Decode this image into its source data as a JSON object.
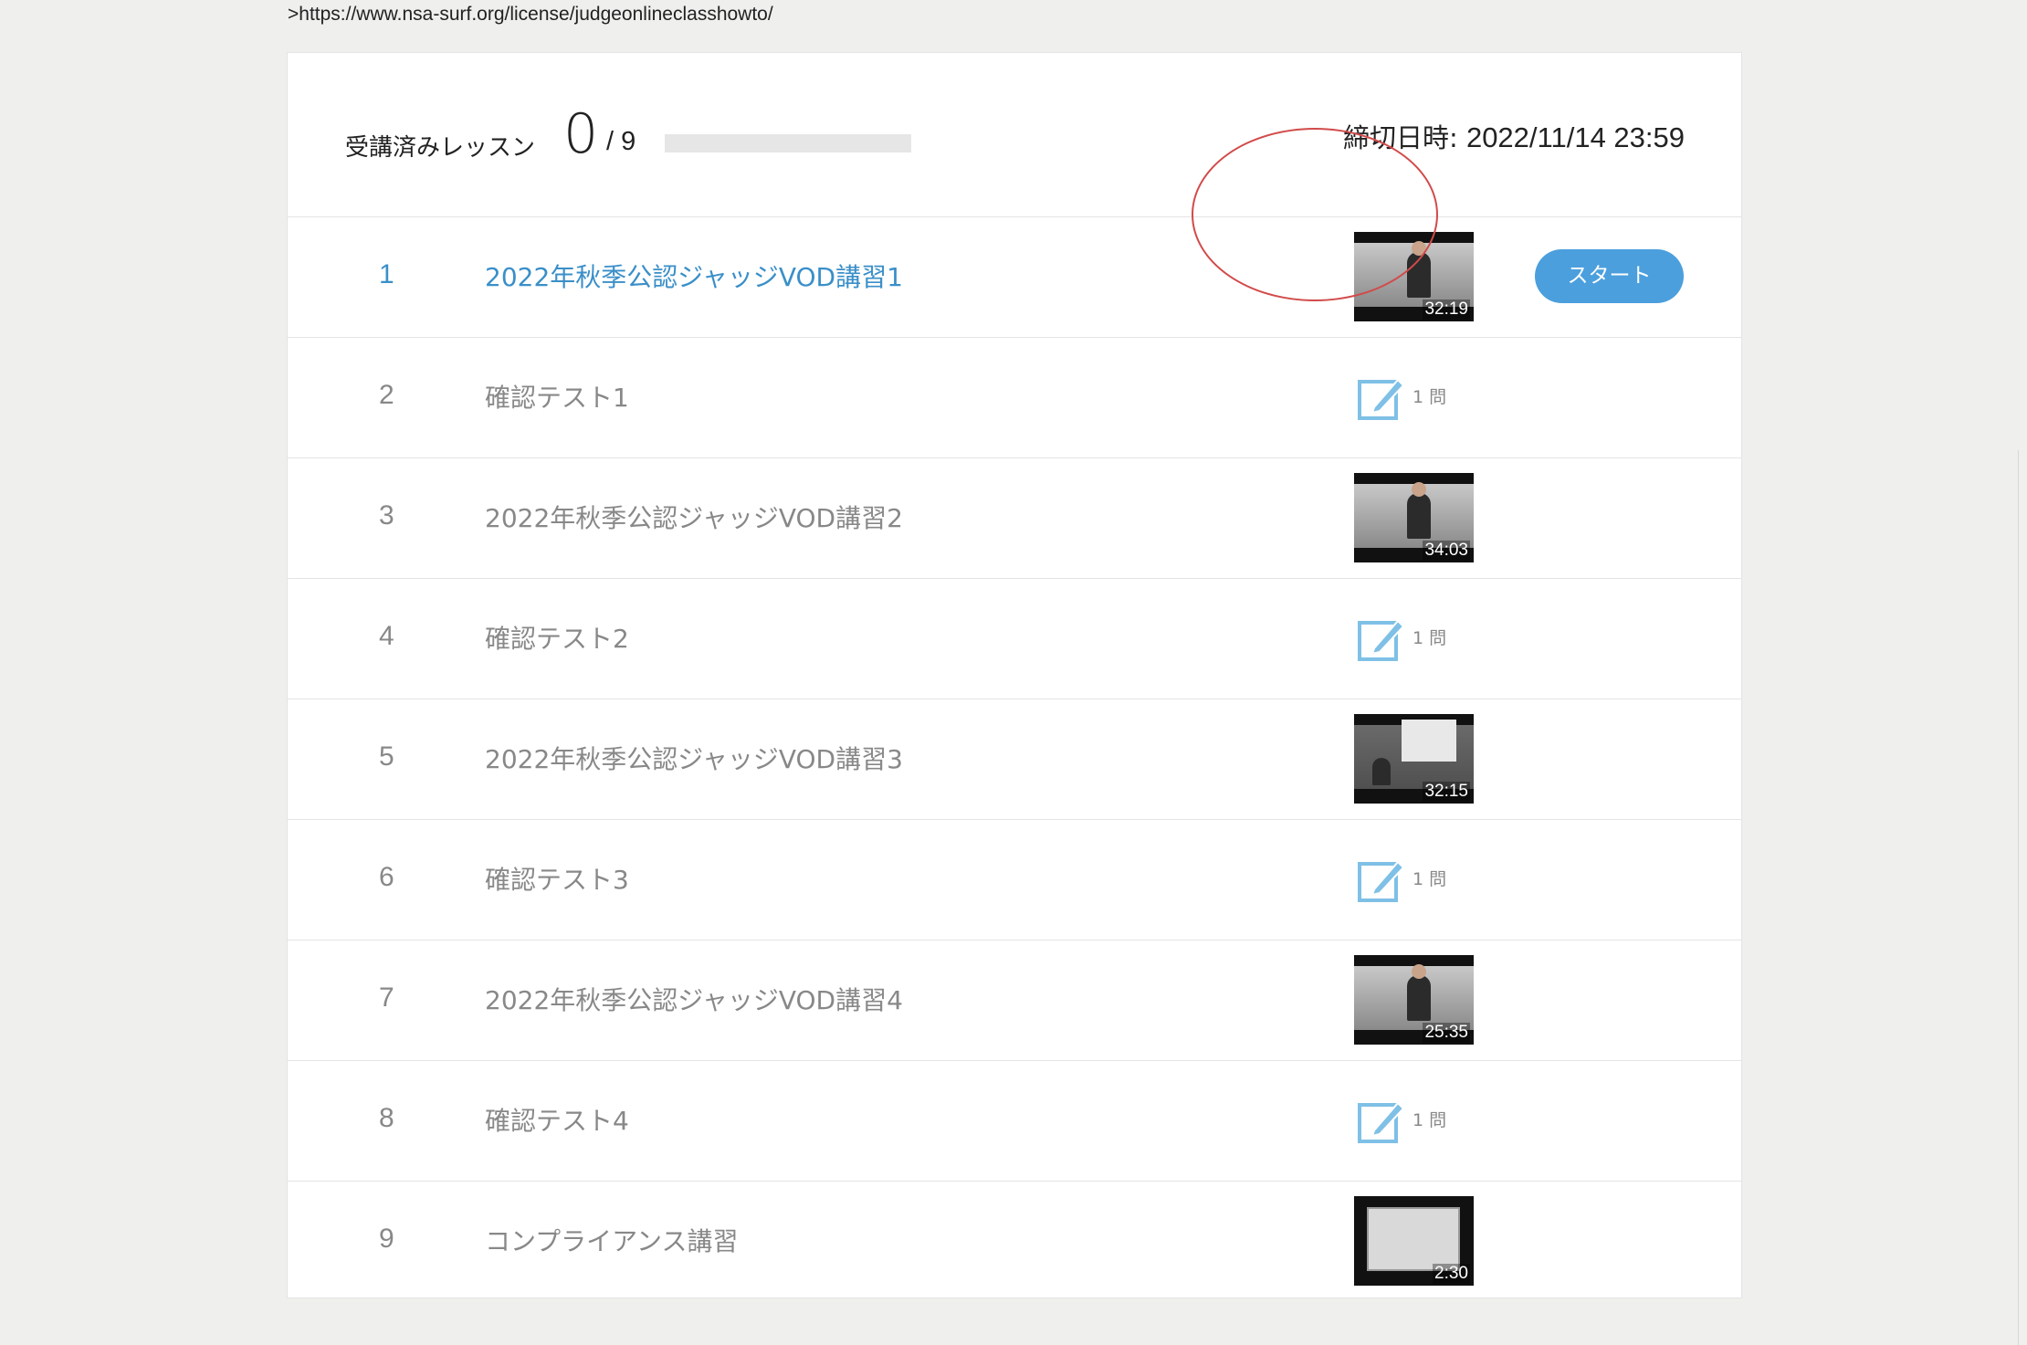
{
  "url_text": ">https://www.nsa-surf.org/license/judgeonlineclasshowto/",
  "progress": {
    "label": "受講済みレッスン",
    "completed": "0",
    "total": "/ 9",
    "fraction": 0
  },
  "deadline": {
    "label": "締切日時: ",
    "value": "2022/11/14 23:59"
  },
  "lessons": [
    {
      "num": "1",
      "title": "2022年秋季公認ジャッジVOD講習1",
      "type": "video",
      "duration": "32:19",
      "active": true,
      "thumb": "speaker"
    },
    {
      "num": "2",
      "title": "確認テスト1",
      "type": "test",
      "count": "1 問"
    },
    {
      "num": "3",
      "title": "2022年秋季公認ジャッジVOD講習2",
      "type": "video",
      "duration": "34:03",
      "thumb": "speaker"
    },
    {
      "num": "4",
      "title": "確認テスト2",
      "type": "test",
      "count": "1 問"
    },
    {
      "num": "5",
      "title": "2022年秋季公認ジャッジVOD講習3",
      "type": "video",
      "duration": "32:15",
      "thumb": "board"
    },
    {
      "num": "6",
      "title": "確認テスト3",
      "type": "test",
      "count": "1 問"
    },
    {
      "num": "7",
      "title": "2022年秋季公認ジャッジVOD講習4",
      "type": "video",
      "duration": "25:35",
      "thumb": "speaker"
    },
    {
      "num": "8",
      "title": "確認テスト4",
      "type": "test",
      "count": "1 問"
    },
    {
      "num": "9",
      "title": "コンプライアンス講習",
      "type": "video",
      "duration": "2:30",
      "thumb": "document"
    }
  ],
  "start_button_label": "スタート",
  "colors": {
    "accent": "#4b9fdd",
    "link": "#3a8fc8",
    "highlight": "#d24a4a",
    "test_icon": "#7fc0e6"
  }
}
